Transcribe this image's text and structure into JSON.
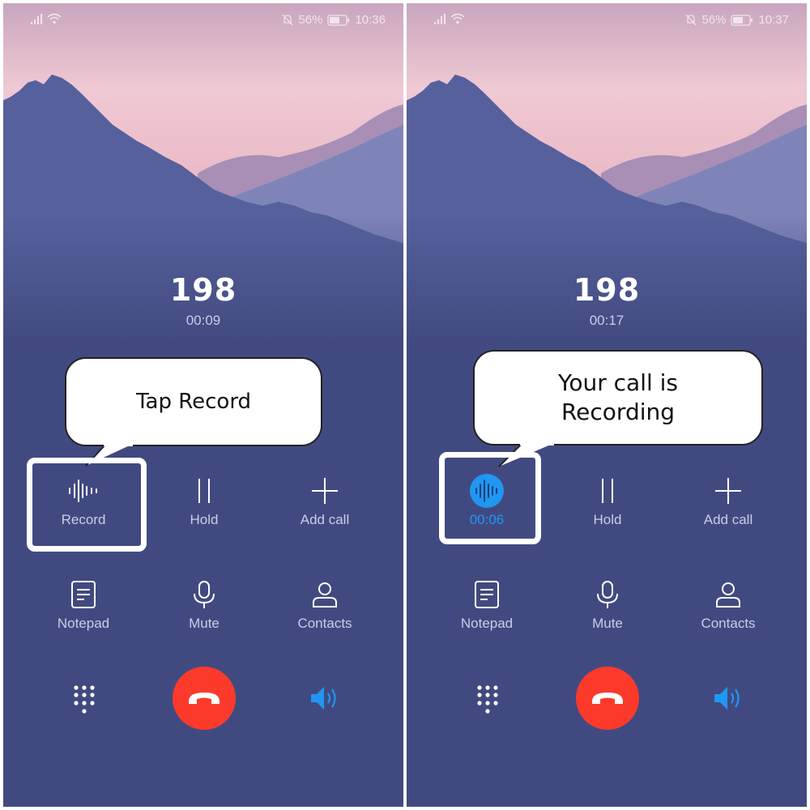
{
  "panels": [
    {
      "status_bar": {
        "battery": "56%",
        "time": "10:36"
      },
      "caller": {
        "number": "198",
        "duration": "00:09"
      },
      "callout": {
        "text": "Tap Record"
      },
      "buttons": {
        "record": "Record",
        "hold": "Hold",
        "add_call": "Add call",
        "notepad": "Notepad",
        "mute": "Mute",
        "contacts": "Contacts"
      },
      "recording_active": false
    },
    {
      "status_bar": {
        "battery": "56%",
        "time": "10:37"
      },
      "caller": {
        "number": "198",
        "duration": "00:17"
      },
      "callout": {
        "line1": "Your call is",
        "line2": "Recording"
      },
      "buttons": {
        "record": "00:06",
        "hold": "Hold",
        "add_call": "Add call",
        "notepad": "Notepad",
        "mute": "Mute",
        "contacts": "Contacts"
      },
      "recording_active": true
    }
  ],
  "colors": {
    "background": "#414a80",
    "end_call": "#fb3a2c",
    "accent_blue": "#2196f3",
    "label": "#c9cde6"
  }
}
